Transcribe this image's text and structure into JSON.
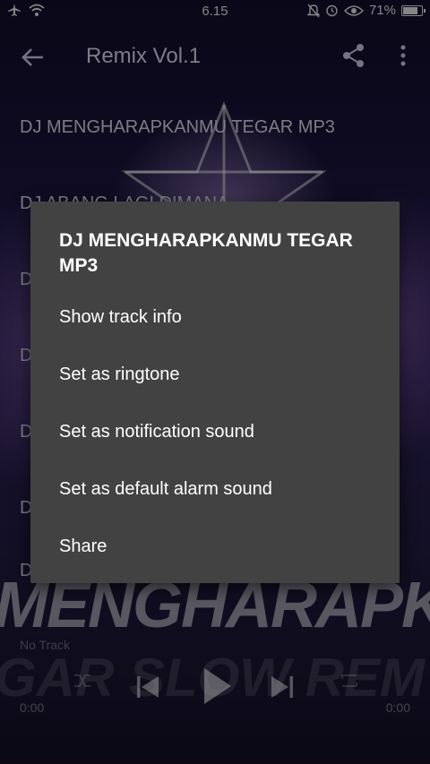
{
  "status_bar": {
    "time": "6.15",
    "battery_percent": "71%",
    "battery_level": 0.71
  },
  "app_bar": {
    "title": "Remix Vol.1"
  },
  "background_art": {
    "big_text": "MENGHARAPKA",
    "big_text2": "GAR SLOW REM"
  },
  "tracks": [
    "DJ MENGHARAPKANMU TEGAR MP3",
    "DJ ABANG LAGI DIMANA",
    "D",
    "D",
    "D",
    "D",
    "DJ SALAH APA AKU (Entah Apa Yg Mer..."
  ],
  "player": {
    "now_playing": "No Track",
    "time_start": "0:00",
    "time_end": "0:00"
  },
  "dialog": {
    "title": "DJ MENGHARAPKANMU TEGAR MP3",
    "items": [
      "Show track info",
      "Set as ringtone",
      "Set as notification sound",
      "Set as default alarm sound",
      "Share"
    ]
  },
  "colors": {
    "dialog_bg": "#424242",
    "background_top": "#120d2a",
    "background_mid": "#2a2050"
  }
}
